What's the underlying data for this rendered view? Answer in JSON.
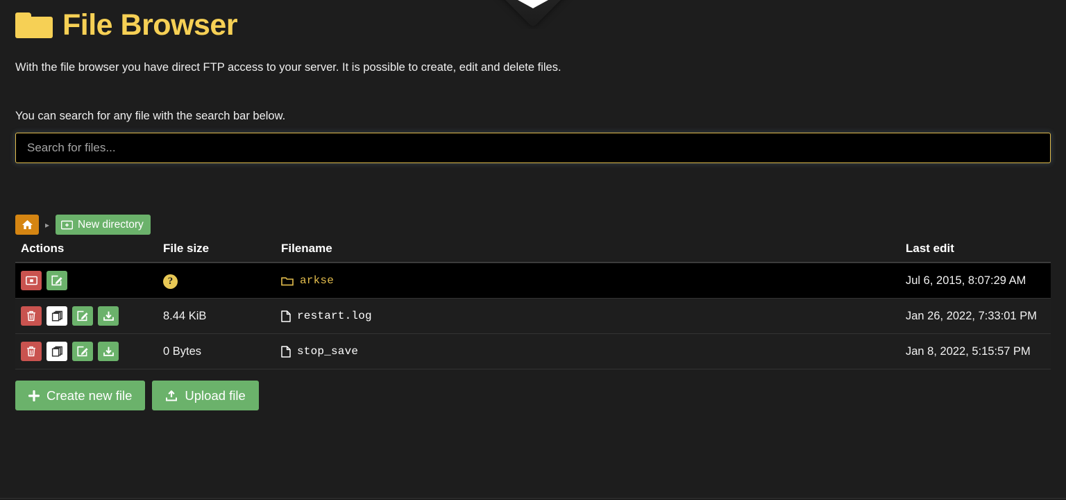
{
  "header": {
    "title": "File Browser",
    "folder_icon": "folder-icon",
    "accent_color": "#f6d055"
  },
  "intro": {
    "description": "With the file browser you have direct FTP access to your server. It is possible to create, edit and delete files.",
    "search_hint": "You can search for any file with the search bar below."
  },
  "search": {
    "placeholder": "Search for files...",
    "value": "",
    "border_color": "#e3bd4d"
  },
  "breadcrumb": {
    "home_icon": "home-icon",
    "separator": "▸",
    "new_directory_label": "New directory",
    "new_directory_icon": "folder-plus-icon",
    "button_color": "#6bb26b",
    "home_color": "#d58512"
  },
  "table": {
    "columns": [
      "Actions",
      "File size",
      "Filename",
      "Last edit"
    ],
    "rows": [
      {
        "type": "directory",
        "active": true,
        "filename": "arkse",
        "file_icon": "folder-outline-icon",
        "size": "?",
        "size_unknown": true,
        "last_edit": "Jul 6, 2015, 8:07:29 AM",
        "actions": [
          {
            "name": "delete-directory-button",
            "icon": "folder-remove-icon",
            "style": "red"
          },
          {
            "name": "rename-directory-button",
            "icon": "pencil-square-icon",
            "style": "green"
          }
        ]
      },
      {
        "type": "file",
        "active": false,
        "filename": "restart.log",
        "file_icon": "file-outline-icon",
        "size": "8.44 KiB",
        "size_unknown": false,
        "last_edit": "Jan 26, 2022, 7:33:01 PM",
        "actions": [
          {
            "name": "delete-file-button",
            "icon": "trash-icon",
            "style": "red"
          },
          {
            "name": "copy-file-button",
            "icon": "copy-icon",
            "style": "white"
          },
          {
            "name": "edit-file-button",
            "icon": "pencil-square-icon",
            "style": "green"
          },
          {
            "name": "download-file-button",
            "icon": "download-icon",
            "style": "green"
          }
        ]
      },
      {
        "type": "file",
        "active": false,
        "filename": "stop_save",
        "file_icon": "file-outline-icon",
        "size": "0 Bytes",
        "size_unknown": false,
        "last_edit": "Jan 8, 2022, 5:15:57 PM",
        "actions": [
          {
            "name": "delete-file-button",
            "icon": "trash-icon",
            "style": "red"
          },
          {
            "name": "copy-file-button",
            "icon": "copy-icon",
            "style": "white"
          },
          {
            "name": "edit-file-button",
            "icon": "pencil-square-icon",
            "style": "green"
          },
          {
            "name": "download-file-button",
            "icon": "download-icon",
            "style": "green"
          }
        ]
      }
    ]
  },
  "footer": {
    "create_file_label": "Create new file",
    "create_file_icon": "plus-icon",
    "upload_file_label": "Upload file",
    "upload_file_icon": "upload-icon"
  }
}
